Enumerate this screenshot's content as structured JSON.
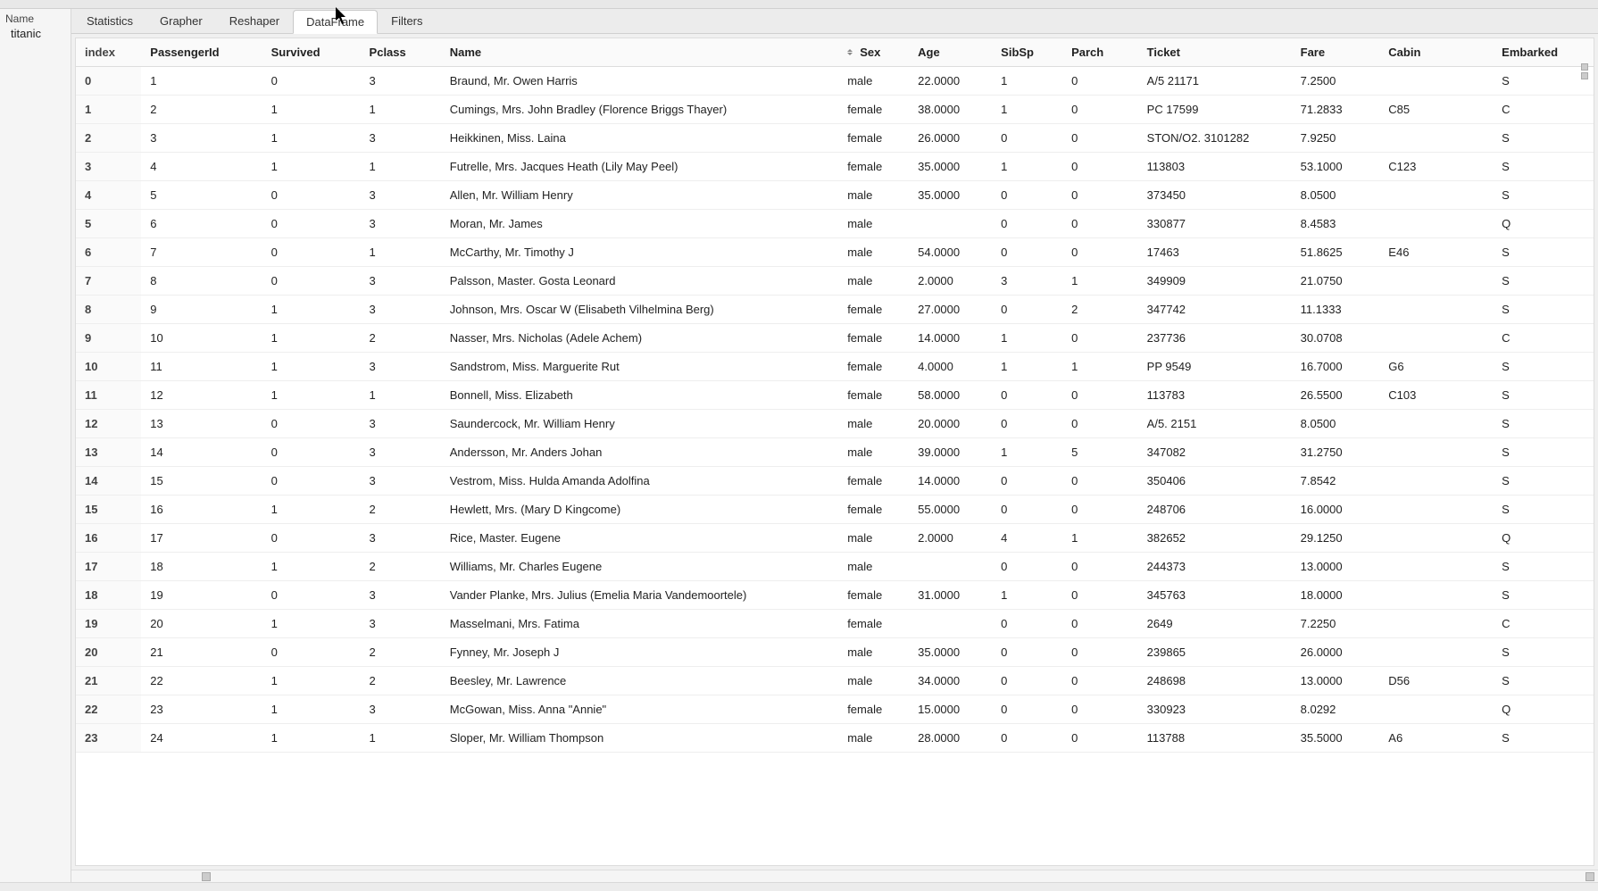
{
  "sidebar": {
    "label": "Name",
    "item": "titanic"
  },
  "tabs": [
    {
      "id": "statistics",
      "label": "Statistics",
      "active": false
    },
    {
      "id": "grapher",
      "label": "Grapher",
      "active": false
    },
    {
      "id": "reshaper",
      "label": "Reshaper",
      "active": false
    },
    {
      "id": "dataframe",
      "label": "DataFrame",
      "active": true
    },
    {
      "id": "filters",
      "label": "Filters",
      "active": false
    }
  ],
  "columns": [
    "index",
    "PassengerId",
    "Survived",
    "Pclass",
    "Name",
    "Sex",
    "Age",
    "SibSp",
    "Parch",
    "Ticket",
    "Fare",
    "Cabin",
    "Embarked"
  ],
  "sort_indicator_column": "Sex",
  "rows": [
    {
      "index": "0",
      "PassengerId": "1",
      "Survived": "0",
      "Pclass": "3",
      "Name": "Braund, Mr. Owen Harris",
      "Sex": "male",
      "Age": "22.0000",
      "SibSp": "1",
      "Parch": "0",
      "Ticket": "A/5 21171",
      "Fare": "7.2500",
      "Cabin": "",
      "Embarked": "S"
    },
    {
      "index": "1",
      "PassengerId": "2",
      "Survived": "1",
      "Pclass": "1",
      "Name": "Cumings, Mrs. John Bradley (Florence Briggs Thayer)",
      "Sex": "female",
      "Age": "38.0000",
      "SibSp": "1",
      "Parch": "0",
      "Ticket": "PC 17599",
      "Fare": "71.2833",
      "Cabin": "C85",
      "Embarked": "C"
    },
    {
      "index": "2",
      "PassengerId": "3",
      "Survived": "1",
      "Pclass": "3",
      "Name": "Heikkinen, Miss. Laina",
      "Sex": "female",
      "Age": "26.0000",
      "SibSp": "0",
      "Parch": "0",
      "Ticket": "STON/O2. 3101282",
      "Fare": "7.9250",
      "Cabin": "",
      "Embarked": "S"
    },
    {
      "index": "3",
      "PassengerId": "4",
      "Survived": "1",
      "Pclass": "1",
      "Name": "Futrelle, Mrs. Jacques Heath (Lily May Peel)",
      "Sex": "female",
      "Age": "35.0000",
      "SibSp": "1",
      "Parch": "0",
      "Ticket": "113803",
      "Fare": "53.1000",
      "Cabin": "C123",
      "Embarked": "S"
    },
    {
      "index": "4",
      "PassengerId": "5",
      "Survived": "0",
      "Pclass": "3",
      "Name": "Allen, Mr. William Henry",
      "Sex": "male",
      "Age": "35.0000",
      "SibSp": "0",
      "Parch": "0",
      "Ticket": "373450",
      "Fare": "8.0500",
      "Cabin": "",
      "Embarked": "S"
    },
    {
      "index": "5",
      "PassengerId": "6",
      "Survived": "0",
      "Pclass": "3",
      "Name": "Moran, Mr. James",
      "Sex": "male",
      "Age": "",
      "SibSp": "0",
      "Parch": "0",
      "Ticket": "330877",
      "Fare": "8.4583",
      "Cabin": "",
      "Embarked": "Q"
    },
    {
      "index": "6",
      "PassengerId": "7",
      "Survived": "0",
      "Pclass": "1",
      "Name": "McCarthy, Mr. Timothy J",
      "Sex": "male",
      "Age": "54.0000",
      "SibSp": "0",
      "Parch": "0",
      "Ticket": "17463",
      "Fare": "51.8625",
      "Cabin": "E46",
      "Embarked": "S"
    },
    {
      "index": "7",
      "PassengerId": "8",
      "Survived": "0",
      "Pclass": "3",
      "Name": "Palsson, Master. Gosta Leonard",
      "Sex": "male",
      "Age": "2.0000",
      "SibSp": "3",
      "Parch": "1",
      "Ticket": "349909",
      "Fare": "21.0750",
      "Cabin": "",
      "Embarked": "S"
    },
    {
      "index": "8",
      "PassengerId": "9",
      "Survived": "1",
      "Pclass": "3",
      "Name": "Johnson, Mrs. Oscar W (Elisabeth Vilhelmina Berg)",
      "Sex": "female",
      "Age": "27.0000",
      "SibSp": "0",
      "Parch": "2",
      "Ticket": "347742",
      "Fare": "11.1333",
      "Cabin": "",
      "Embarked": "S"
    },
    {
      "index": "9",
      "PassengerId": "10",
      "Survived": "1",
      "Pclass": "2",
      "Name": "Nasser, Mrs. Nicholas (Adele Achem)",
      "Sex": "female",
      "Age": "14.0000",
      "SibSp": "1",
      "Parch": "0",
      "Ticket": "237736",
      "Fare": "30.0708",
      "Cabin": "",
      "Embarked": "C"
    },
    {
      "index": "10",
      "PassengerId": "11",
      "Survived": "1",
      "Pclass": "3",
      "Name": "Sandstrom, Miss. Marguerite Rut",
      "Sex": "female",
      "Age": "4.0000",
      "SibSp": "1",
      "Parch": "1",
      "Ticket": "PP 9549",
      "Fare": "16.7000",
      "Cabin": "G6",
      "Embarked": "S"
    },
    {
      "index": "11",
      "PassengerId": "12",
      "Survived": "1",
      "Pclass": "1",
      "Name": "Bonnell, Miss. Elizabeth",
      "Sex": "female",
      "Age": "58.0000",
      "SibSp": "0",
      "Parch": "0",
      "Ticket": "113783",
      "Fare": "26.5500",
      "Cabin": "C103",
      "Embarked": "S"
    },
    {
      "index": "12",
      "PassengerId": "13",
      "Survived": "0",
      "Pclass": "3",
      "Name": "Saundercock, Mr. William Henry",
      "Sex": "male",
      "Age": "20.0000",
      "SibSp": "0",
      "Parch": "0",
      "Ticket": "A/5. 2151",
      "Fare": "8.0500",
      "Cabin": "",
      "Embarked": "S"
    },
    {
      "index": "13",
      "PassengerId": "14",
      "Survived": "0",
      "Pclass": "3",
      "Name": "Andersson, Mr. Anders Johan",
      "Sex": "male",
      "Age": "39.0000",
      "SibSp": "1",
      "Parch": "5",
      "Ticket": "347082",
      "Fare": "31.2750",
      "Cabin": "",
      "Embarked": "S"
    },
    {
      "index": "14",
      "PassengerId": "15",
      "Survived": "0",
      "Pclass": "3",
      "Name": "Vestrom, Miss. Hulda Amanda Adolfina",
      "Sex": "female",
      "Age": "14.0000",
      "SibSp": "0",
      "Parch": "0",
      "Ticket": "350406",
      "Fare": "7.8542",
      "Cabin": "",
      "Embarked": "S"
    },
    {
      "index": "15",
      "PassengerId": "16",
      "Survived": "1",
      "Pclass": "2",
      "Name": "Hewlett, Mrs. (Mary D Kingcome)",
      "Sex": "female",
      "Age": "55.0000",
      "SibSp": "0",
      "Parch": "0",
      "Ticket": "248706",
      "Fare": "16.0000",
      "Cabin": "",
      "Embarked": "S"
    },
    {
      "index": "16",
      "PassengerId": "17",
      "Survived": "0",
      "Pclass": "3",
      "Name": "Rice, Master. Eugene",
      "Sex": "male",
      "Age": "2.0000",
      "SibSp": "4",
      "Parch": "1",
      "Ticket": "382652",
      "Fare": "29.1250",
      "Cabin": "",
      "Embarked": "Q"
    },
    {
      "index": "17",
      "PassengerId": "18",
      "Survived": "1",
      "Pclass": "2",
      "Name": "Williams, Mr. Charles Eugene",
      "Sex": "male",
      "Age": "",
      "SibSp": "0",
      "Parch": "0",
      "Ticket": "244373",
      "Fare": "13.0000",
      "Cabin": "",
      "Embarked": "S"
    },
    {
      "index": "18",
      "PassengerId": "19",
      "Survived": "0",
      "Pclass": "3",
      "Name": "Vander Planke, Mrs. Julius (Emelia Maria Vandemoortele)",
      "Sex": "female",
      "Age": "31.0000",
      "SibSp": "1",
      "Parch": "0",
      "Ticket": "345763",
      "Fare": "18.0000",
      "Cabin": "",
      "Embarked": "S"
    },
    {
      "index": "19",
      "PassengerId": "20",
      "Survived": "1",
      "Pclass": "3",
      "Name": "Masselmani, Mrs. Fatima",
      "Sex": "female",
      "Age": "",
      "SibSp": "0",
      "Parch": "0",
      "Ticket": "2649",
      "Fare": "7.2250",
      "Cabin": "",
      "Embarked": "C"
    },
    {
      "index": "20",
      "PassengerId": "21",
      "Survived": "0",
      "Pclass": "2",
      "Name": "Fynney, Mr. Joseph J",
      "Sex": "male",
      "Age": "35.0000",
      "SibSp": "0",
      "Parch": "0",
      "Ticket": "239865",
      "Fare": "26.0000",
      "Cabin": "",
      "Embarked": "S"
    },
    {
      "index": "21",
      "PassengerId": "22",
      "Survived": "1",
      "Pclass": "2",
      "Name": "Beesley, Mr. Lawrence",
      "Sex": "male",
      "Age": "34.0000",
      "SibSp": "0",
      "Parch": "0",
      "Ticket": "248698",
      "Fare": "13.0000",
      "Cabin": "D56",
      "Embarked": "S"
    },
    {
      "index": "22",
      "PassengerId": "23",
      "Survived": "1",
      "Pclass": "3",
      "Name": "McGowan, Miss. Anna \"Annie\"",
      "Sex": "female",
      "Age": "15.0000",
      "SibSp": "0",
      "Parch": "0",
      "Ticket": "330923",
      "Fare": "8.0292",
      "Cabin": "",
      "Embarked": "Q"
    },
    {
      "index": "23",
      "PassengerId": "24",
      "Survived": "1",
      "Pclass": "1",
      "Name": "Sloper, Mr. William Thompson",
      "Sex": "male",
      "Age": "28.0000",
      "SibSp": "0",
      "Parch": "0",
      "Ticket": "113788",
      "Fare": "35.5000",
      "Cabin": "A6",
      "Embarked": "S"
    }
  ]
}
